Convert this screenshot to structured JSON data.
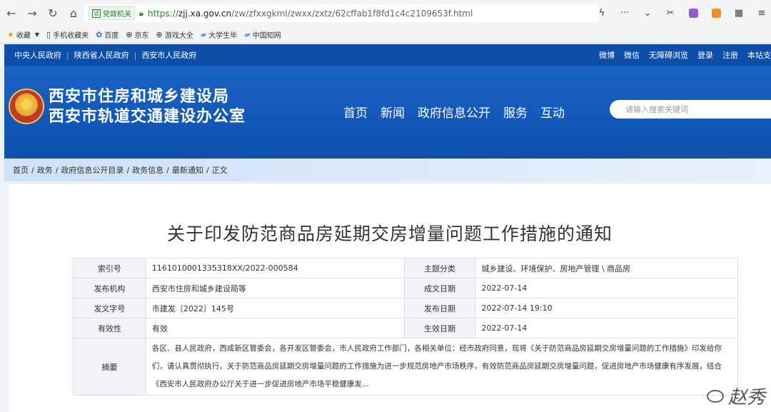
{
  "browser": {
    "gov_label": "党政机关",
    "url_scheme": "https://",
    "url_host": "zjj.xa.gov.cn",
    "url_path": "/zw/zfxxgkml/zwxx/zxtz/62cffab1f8fd1c4c2109653f.html"
  },
  "bookmarks": [
    {
      "label": "收藏",
      "icon": "star-icon"
    },
    {
      "label": "手机收藏夹",
      "icon": "phone-icon"
    },
    {
      "label": "百度",
      "icon": "baidu-icon"
    },
    {
      "label": "京东",
      "icon": "globe-icon"
    },
    {
      "label": "游戏大全",
      "icon": "globe-icon"
    },
    {
      "label": "大学生毕",
      "icon": "folder-icon"
    },
    {
      "label": "中国知网",
      "icon": "folder-icon"
    }
  ],
  "strip": {
    "links": [
      "中央人民政府",
      "陕西省人民政府",
      "西安市人民政府"
    ],
    "right": [
      "微博",
      "微信",
      "无障碍浏览",
      "登录",
      "注册",
      "本站支"
    ]
  },
  "header": {
    "name_line1": "西安市住房和城乡建设局",
    "name_line2": "西安市轨道交通建设办公室",
    "nav": [
      "首页",
      "新闻",
      "政府信息公开",
      "服务",
      "互动"
    ],
    "search_placeholder": "请输入搜索关键词"
  },
  "breadcrumb": [
    "首页",
    "政务",
    "政府信息公开目录",
    "政务信息",
    "最新通知",
    "正文"
  ],
  "article": {
    "title": "关于印发防范商品房延期交房增量问题工作措施的通知",
    "meta": {
      "index_label": "索引号",
      "index_value": "1161010001335318XX/2022-000584",
      "topic_label": "主题分类",
      "topic_value": "城乡建设、环境保护、房地产管理 \\ 商品房",
      "org_label": "发布机构",
      "org_value": "西安市住房和城乡建设局等",
      "date_label": "成文日期",
      "date_value": "2022-07-14",
      "docno_label": "发文字号",
      "docno_value": "市建发〔2022〕145号",
      "pubdate_label": "发布日期",
      "pubdate_value": "2022-07-14 19:10",
      "valid_label": "有效性",
      "valid_value": "有效",
      "effective_label": "生效日期",
      "effective_value": "2022-07-14",
      "abstract_label": "摘要",
      "abstract_value": "各区、县人民政府，西咸新区管委会，各开发区管委会，市人民政府工作部门，各相关单位：经市政府同意，现将《关于防范商品房延期交房增量问题的工作措施》印发给你们，请认真贯彻执行。关于防范商品房延期交房增量问题的工作措施为进一步规范房地产市场秩序，有效防范商品房延期交房增量问题，促进房地产市场健康有序发展，结合《西安市人民政府办公厅关于进一步促进房地产市场平稳健康发..."
    }
  },
  "watermark": "赵秀"
}
